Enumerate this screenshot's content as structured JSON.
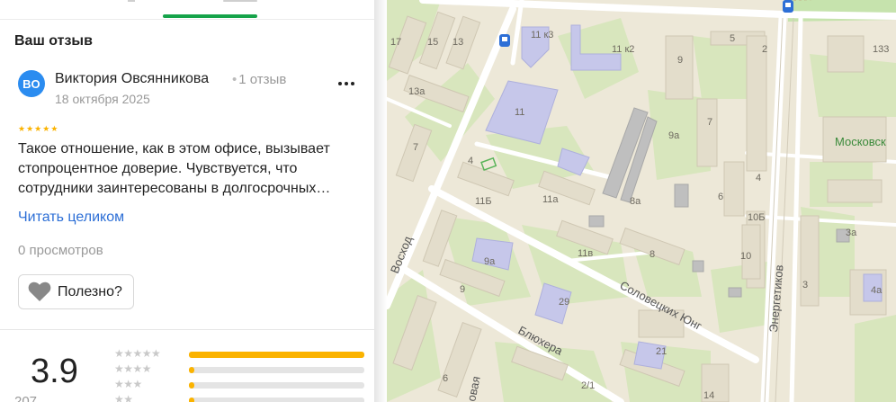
{
  "review": {
    "section_title": "Ваш отзыв",
    "author": {
      "initials": "ВО",
      "name": "Виктория Овсянникова",
      "review_count": "1 отзыв",
      "avatar_color": "#2b8cf0"
    },
    "date": "18 октября 2025",
    "rating_stars": 5,
    "text_lines": [
      "Такое отношение, как в этом офисе, вызывает",
      "стопроцентное доверие. Чувствуется, что",
      "сотрудники заинтересованы в долгосрочных…"
    ],
    "read_more_label": "Читать целиком",
    "views": "0 просмотров",
    "useful_label": "Полезно?"
  },
  "rating": {
    "value": "3.9",
    "sub": "207",
    "distribution": [
      {
        "stars": 5,
        "fill": 1.0
      },
      {
        "stars": 4,
        "fill": 0.03
      },
      {
        "stars": 3,
        "fill": 0.03
      },
      {
        "stars": 2,
        "fill": 0.03
      }
    ]
  },
  "colors": {
    "accent_green": "#16a34a",
    "star_gold": "#fbb300",
    "link_blue": "#2d6fd6"
  },
  "map": {
    "streets": [
      "Восход",
      "Соловецких Юнг",
      "Блюхера",
      "Энергетиков",
      "Московск"
    ],
    "building_labels": [
      "17",
      "15",
      "13",
      "13а",
      "11 к3",
      "11 к2",
      "5",
      "2",
      "133",
      "9",
      "11",
      "9а",
      "7",
      "7",
      "4",
      "11Б",
      "11а",
      "8а",
      "4",
      "6",
      "10Б",
      "3а",
      "10",
      "9а",
      "11в",
      "8",
      "9",
      "29",
      "3",
      "4а",
      "21",
      "6",
      "2/1",
      "14",
      "овая"
    ]
  }
}
